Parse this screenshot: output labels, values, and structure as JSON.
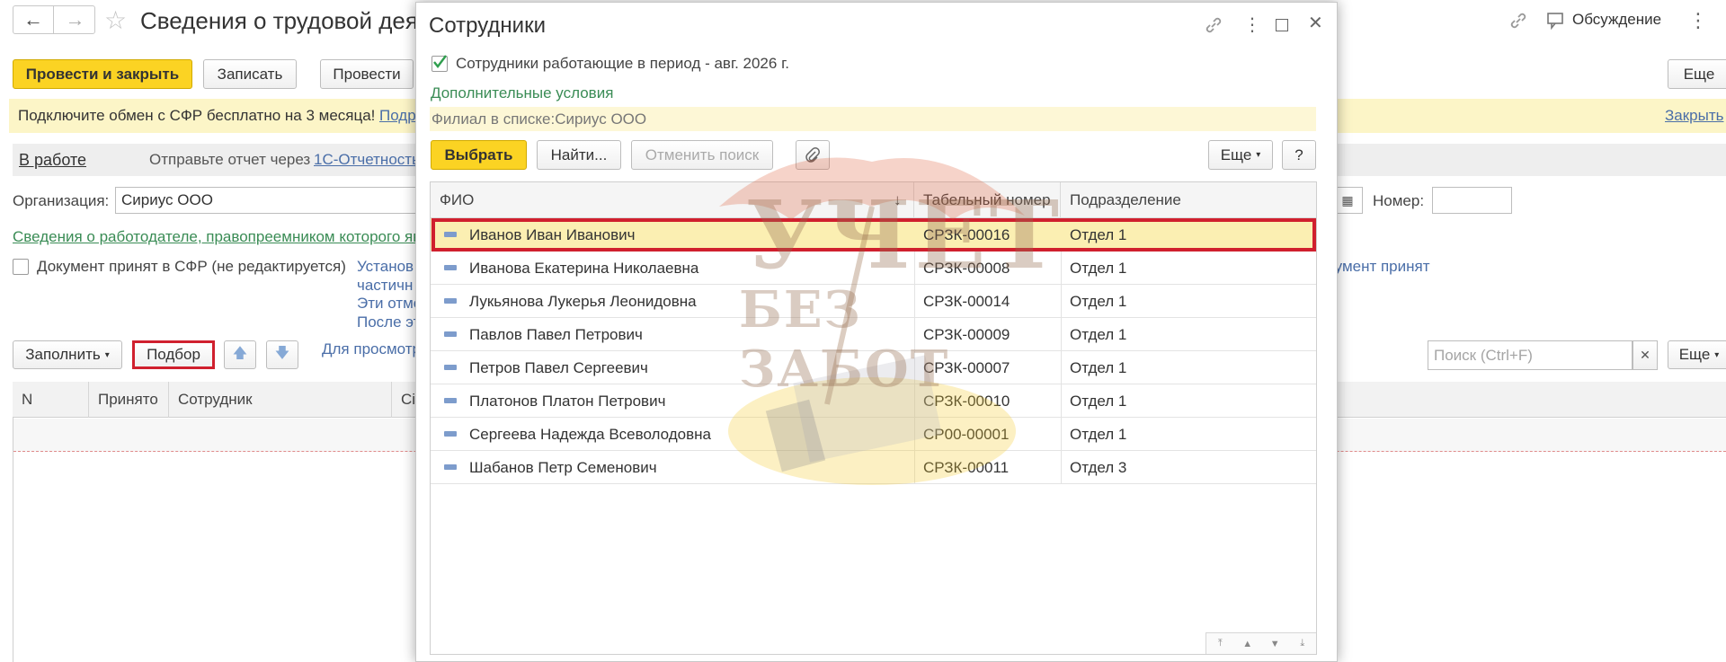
{
  "window": {
    "title": "Сведения о трудовой деятельности",
    "title_visible": "Сведения о трудовой деяте",
    "discussion": "Обсуждение"
  },
  "toolbar": {
    "post_close": "Провести и закрыть",
    "save": "Записать",
    "post": "Провести",
    "more": "Еще"
  },
  "banner": {
    "text": "Подключите обмен с СФР бесплатно на 3 месяца!",
    "link": "Подр",
    "close": "Закрыть"
  },
  "status": {
    "state": "В работе",
    "send_text": "Отправьте отчет через",
    "send_link": "1С-Отчетность"
  },
  "form": {
    "org_label": "Организация:",
    "org_value": "Сириус ООО",
    "number_label": "Номер:",
    "employer_link": "Сведения о работодателе, правопреемником которого яв",
    "accepted_label": "Документ принят в СФР (не редактируется)",
    "info_lines": [
      "Установ",
      "частичн",
      "Эти отме",
      "После эт"
    ],
    "info_right": "кумент принят"
  },
  "table_toolbar": {
    "fill": "Заполнить",
    "pick": "Подбор",
    "view_text": "Для просмотр",
    "search_placeholder": "Поиск (Ctrl+F)",
    "more": "Еще"
  },
  "main_table": {
    "columns": [
      "N",
      "Принято",
      "Сотрудник",
      "Сі"
    ]
  },
  "modal": {
    "title": "Сотрудники",
    "period_checkbox": "Сотрудники работающие в период - авг. 2026 г.",
    "extra_conditions": "Дополнительные условия",
    "filter": "Филиал в списке:Сириус ООО",
    "btn_select": "Выбрать",
    "btn_find": "Найти...",
    "btn_cancel_search": "Отменить поиск",
    "btn_more": "Еще",
    "btn_help": "?",
    "columns": {
      "fio": "ФИО",
      "tab_number": "Табельный номер",
      "department": "Подразделение",
      "sort_arrow": "↓"
    },
    "rows": [
      {
        "fio": "Иванов Иван Иванович",
        "tab": "СРЗК-00016",
        "dept": "Отдел 1"
      },
      {
        "fio": "Иванова Екатерина Николаевна",
        "tab": "СРЗК-00008",
        "dept": "Отдел 1"
      },
      {
        "fio": "Лукьянова Лукерья Леонидовна",
        "tab": "СРЗК-00014",
        "dept": "Отдел 1"
      },
      {
        "fio": "Павлов Павел Петрович",
        "tab": "СРЗК-00009",
        "dept": "Отдел 1"
      },
      {
        "fio": "Петров Павел Сергеевич",
        "tab": "СРЗК-00007",
        "dept": "Отдел 1"
      },
      {
        "fio": "Платонов Платон Петрович",
        "tab": "СРЗК-00010",
        "dept": "Отдел 1"
      },
      {
        "fio": "Сергеева Надежда Всеволодовна",
        "tab": "СР00-00001",
        "dept": "Отдел 1"
      },
      {
        "fio": "Шабанов Петр Семенович",
        "tab": "СРЗК-00011",
        "dept": "Отдел 3"
      }
    ]
  },
  "watermark": {
    "line1": "УЧЕТ",
    "line2": "БЕЗ ЗАБОТ"
  },
  "colors": {
    "accent_yellow": "#fbd323",
    "highlight_red": "#d0202e",
    "link_green": "#3a8c55",
    "banner_bg": "#fcf5c7"
  }
}
